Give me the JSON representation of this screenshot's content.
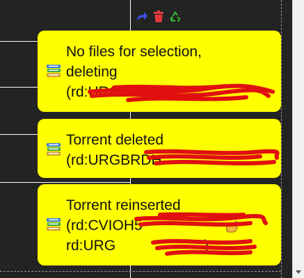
{
  "toolbar": {
    "icons": [
      "redo-arrow-icon",
      "trash-icon",
      "recycle-icon"
    ],
    "colors": {
      "redo": "#3d4fe0",
      "trash": "#e23b3b",
      "recycle": "#2eb82e"
    }
  },
  "toasts": [
    {
      "icon": "books-icon",
      "line1": "No files for selection,",
      "line2": "deleting",
      "line3": "(rd:URGBI"
    },
    {
      "icon": "books-icon",
      "line1": "Torrent deleted",
      "line2": "(rd:URGBRDH"
    },
    {
      "icon": "books-icon",
      "line1": "Torrent reinserted",
      "line2": "(rd:CVIOH5",
      "line3": "rd:URG",
      "line3_end": ")"
    }
  ],
  "colors": {
    "toast_bg": "#ffff00",
    "redaction": "#e01010",
    "background": "#232323"
  }
}
